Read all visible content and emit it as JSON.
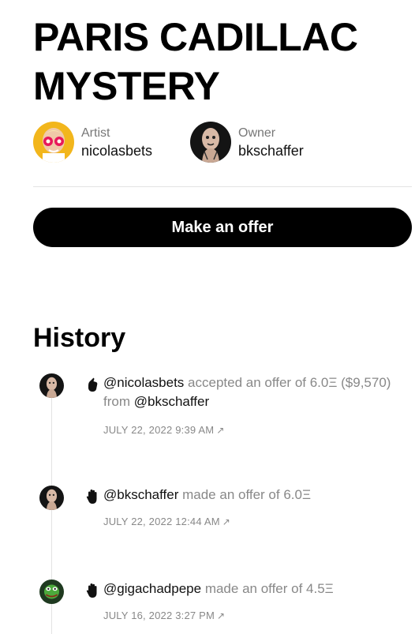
{
  "title": "PARIS CADILLAC MYSTERY",
  "artist": {
    "role": "Artist",
    "name": "nicolasbets"
  },
  "owner": {
    "role": "Owner",
    "name": "bkschaffer"
  },
  "make_offer_label": "Make an offer",
  "history_title": "History",
  "history": [
    {
      "icon": "hand-accept-icon",
      "actor": "@nicolasbets",
      "action_1": " accepted an offer of 6.0Ξ ($9,570) from ",
      "counterparty": "@bkschaffer",
      "date": "JULY 22, 2022 9:39 AM",
      "date_arrow": "↗"
    },
    {
      "icon": "hand-offer-icon",
      "actor": "@bkschaffer",
      "action_1": " made an offer of 6.0Ξ",
      "date": "JULY 22, 2022 12:44 AM",
      "date_arrow": "↗"
    },
    {
      "icon": "hand-offer-icon",
      "actor": "@gigachadpepe",
      "action_1": " made an offer of 4.5Ξ",
      "date": "JULY 16, 2022 3:27 PM",
      "date_arrow": "↗"
    }
  ],
  "colors": {
    "accent": "#000000",
    "muted": "#888888",
    "divider": "#e3e3e3"
  }
}
